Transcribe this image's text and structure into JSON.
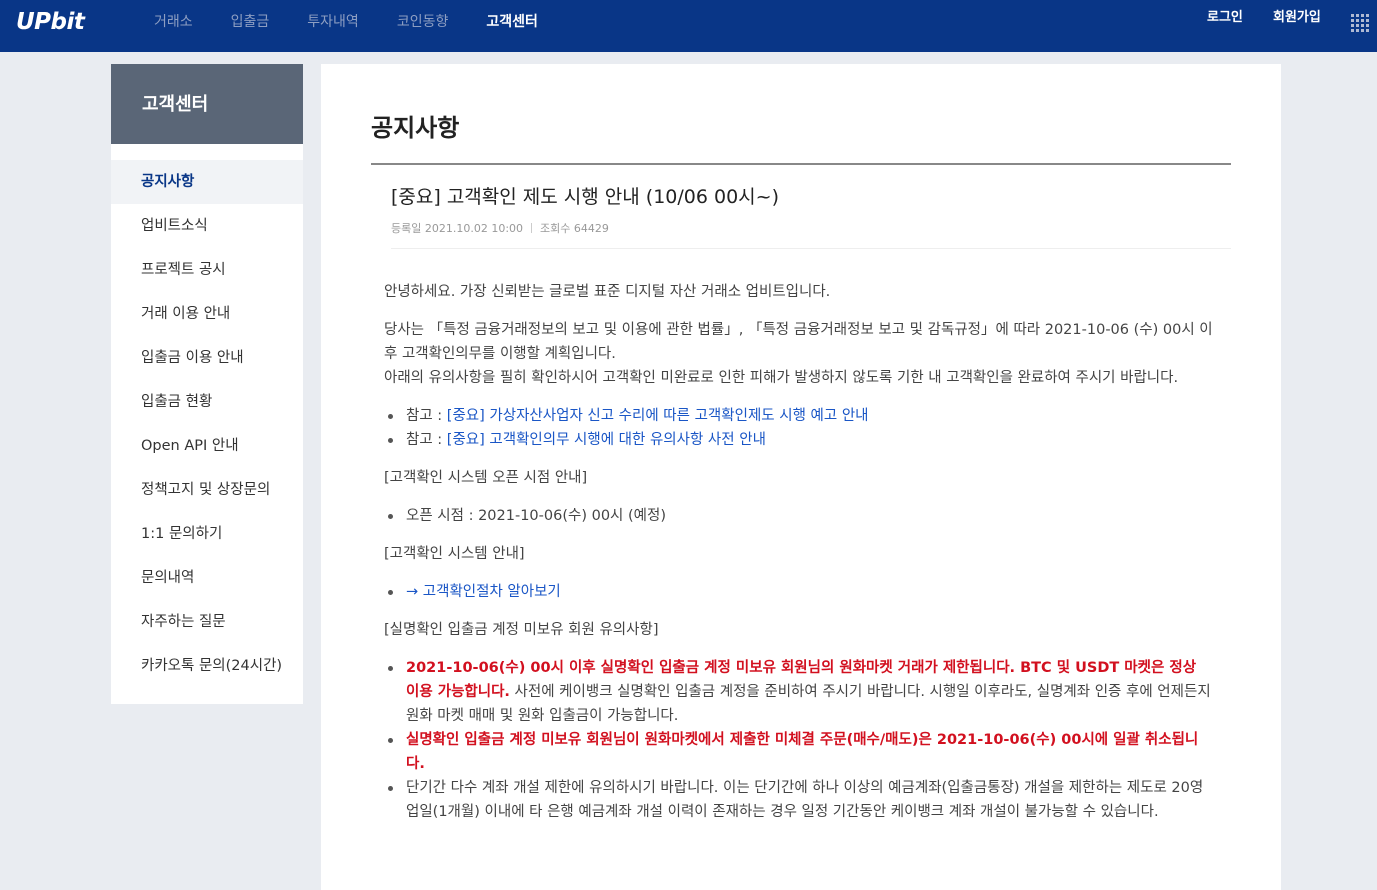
{
  "header": {
    "logo": "UPbit",
    "nav": [
      "거래소",
      "입출금",
      "투자내역",
      "코인동향",
      "고객센터"
    ],
    "active_nav": "고객센터",
    "login": "로그인",
    "signup": "회원가입"
  },
  "sidebar": {
    "title": "고객센터",
    "items": [
      {
        "label": "공지사항",
        "active": true
      },
      {
        "label": "업비트소식"
      },
      {
        "label": "프로젝트 공시"
      },
      {
        "label": "거래 이용 안내"
      },
      {
        "label": "입출금 이용 안내"
      },
      {
        "label": "입출금 현황"
      },
      {
        "label": "Open API 안내"
      },
      {
        "label": "정책고지 및 상장문의"
      },
      {
        "label": "1:1 문의하기"
      },
      {
        "label": "문의내역"
      },
      {
        "label": "자주하는 질문"
      },
      {
        "label": "카카오톡 문의(24시간)"
      }
    ]
  },
  "main": {
    "page_title": "공지사항",
    "notice": {
      "title": "[중요] 고객확인 제도 시행 안내 (10/06 00시~)",
      "date_label": "등록일 2021.10.02 10:00",
      "views_label": "조회수 64429"
    },
    "content": {
      "greeting": "안녕하세요. 가장 신뢰받는 글로벌 표준 디지털 자산 거래소 업비트입니다.",
      "intro_1": "당사는 「특정 금융거래정보의 보고 및 이용에 관한 법률」, 「특정 금융거래정보 보고 및 감독규정」에 따라 2021-10-06 (수) 00시 이후 고객확인의무를 이행할 계획입니다.",
      "intro_2": "아래의 유의사항을 필히 확인하시어 고객확인 미완료로 인한 피해가 발생하지 않도록 기한 내 고객확인을 완료하여 주시기 바랍니다.",
      "ref_prefix": "참고 : ",
      "ref_1": "[중요] 가상자산사업자 신고 수리에 따른 고객확인제도 시행 예고 안내",
      "ref_2": "[중요] 고객확인의무 시행에 대한 유의사항 사전 안내",
      "section_1": "[고객확인 시스템 오픈 시점 안내]",
      "open_time": "오픈 시점 : 2021-10-06(수) 00시 (예정)",
      "section_2": "[고객확인 시스템 안내]",
      "procedure_link": "→ 고객확인절차 알아보기",
      "section_3": "[실명확인 입출금 계정 미보유 회원 유의사항]",
      "warn_1_red": "2021-10-06(수) 00시 이후 실명확인 입출금 계정 미보유 회원님의 원화마켓 거래가 제한됩니다. BTC 및 USDT 마켓은 정상 이용 가능합니다.",
      "warn_1_rest": " 사전에 케이뱅크 실명확인 입출금 계정을 준비하여 주시기 바랍니다. 시행일 이후라도, 실명계좌 인증 후에 언제든지 원화 마켓 매매 및 원화 입출금이 가능합니다.",
      "warn_2_red": "실명확인 입출금 계정 미보유 회원님이 원화마켓에서 제출한 미체결 주문(매수/매도)은 2021-10-06(수) 00시에 일괄 취소됩니다.",
      "warn_3": "단기간 다수 계좌 개설 제한에 유의하시기 바랍니다. 이는 단기간에 하나 이상의 예금계좌(입출금통장) 개설을 제한하는 제도로 20영업일(1개월) 이내에 타 은행 예금계좌 개설 이력이 존재하는 경우 일정 기간동안 케이뱅크 계좌 개설이 불가능할 수 있습니다."
    }
  }
}
